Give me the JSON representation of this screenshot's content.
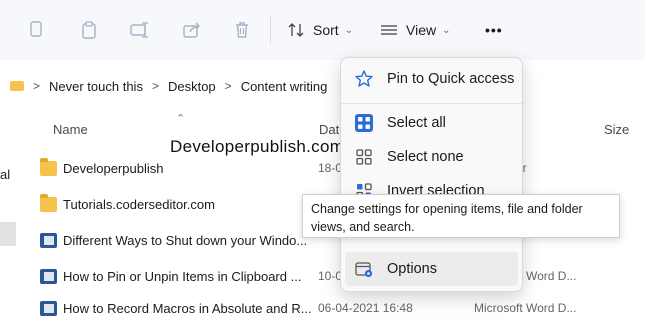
{
  "toolbar": {
    "icons": [
      "copy-icon",
      "paste-icon",
      "rename-icon",
      "share-icon",
      "delete-icon"
    ],
    "sort_label": "Sort",
    "view_label": "View",
    "more_label": "•••"
  },
  "breadcrumb": {
    "items": [
      "Never touch this",
      "Desktop",
      "Content writing"
    ]
  },
  "columns": {
    "name": "Name",
    "date": "Dat",
    "size": "Size"
  },
  "left_pane": {
    "partial_label": "al"
  },
  "watermark": "Developerpublish.com",
  "files": [
    {
      "name": "Developerpublish",
      "date": "18-0",
      "type": "er",
      "icon": "folder"
    },
    {
      "name": "Tutorials.coderseditor.com",
      "date": "",
      "type": "",
      "icon": "folder"
    },
    {
      "name": "Different Ways to Shut down your Windo...",
      "date": "",
      "type": "",
      "icon": "doc"
    },
    {
      "name": "How to Pin or Unpin Items in Clipboard ...",
      "date": "10-0",
      "type": "ft Word D...",
      "icon": "doc"
    },
    {
      "name": "How to Record Macros in Absolute and R...",
      "date": "06-04-2021 16:48",
      "type": "Microsoft Word D...",
      "icon": "doc"
    }
  ],
  "menu": {
    "items": [
      {
        "label": "Pin to Quick access",
        "icon": "star-icon"
      },
      {
        "label": "Select all",
        "icon": "select-all-icon"
      },
      {
        "label": "Select none",
        "icon": "select-none-icon"
      },
      {
        "label": "Invert selection",
        "icon": "invert-selection-icon"
      },
      {
        "label": "Options",
        "icon": "options-icon"
      }
    ]
  },
  "tooltip": "Change settings for opening items, file and folder views, and search.",
  "colors": {
    "accent": "#2b6fd6",
    "folder": "#f5c34b",
    "word": "#2b579a"
  }
}
